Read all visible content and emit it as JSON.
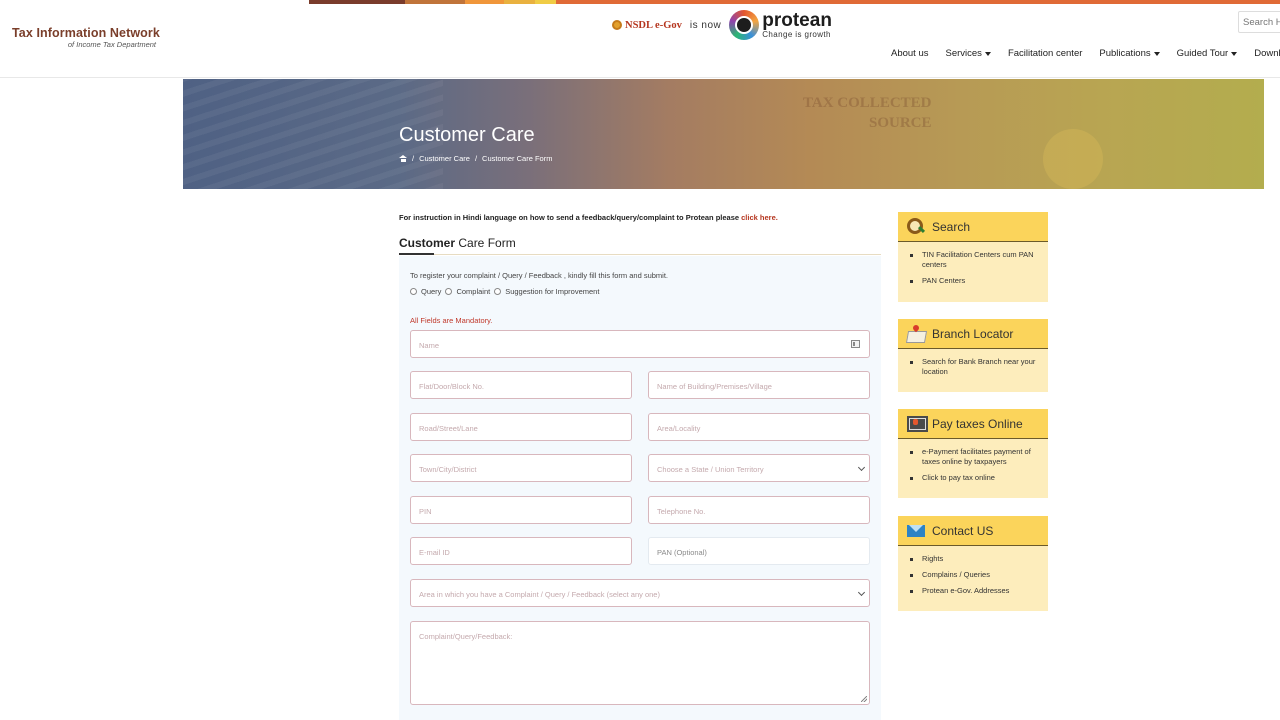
{
  "header": {
    "stripe_colors": [
      "#7a3c2c",
      "#c0743a",
      "#f0963a",
      "#e9b13f",
      "#f0cc45",
      "#e06a36"
    ],
    "logo_title": "Tax Information Network",
    "logo_subtitle": "of Income Tax Department",
    "brand_old": "NSDL e-Gov",
    "brand_connector": "is now",
    "brand_new": "protean",
    "brand_tagline": "Change is growth",
    "search_placeholder": "Search H",
    "nav": [
      {
        "label": "About us",
        "dropdown": false
      },
      {
        "label": "Services",
        "dropdown": true
      },
      {
        "label": "Facilitation center",
        "dropdown": false
      },
      {
        "label": "Publications",
        "dropdown": true
      },
      {
        "label": "Guided Tour",
        "dropdown": true
      },
      {
        "label": "Download",
        "dropdown": false
      }
    ]
  },
  "banner": {
    "title": "Customer Care",
    "breadcrumb": [
      "Customer Care",
      "Customer Care Form"
    ],
    "watermark": [
      "TAX COLLECTED",
      "SOURCE"
    ]
  },
  "main": {
    "instruction_text": "For instruction in Hindi language on how to send a feedback/query/complaint to Protean please ",
    "instruction_link": "click here.",
    "form_heading_bold": "Customer",
    "form_heading_rest": " Care Form",
    "intro": "To register your complaint / Query / Feedback , kindly fill this form and submit.",
    "radio_options": [
      "Query",
      "Complaint",
      "Suggestion for Improvement"
    ],
    "mandatory_note": "All Fields are Mandatory.",
    "fields": {
      "name": "Name",
      "flat": "Flat/Door/Block No.",
      "building": "Name of Building/Premises/Village",
      "road": "Road/Street/Lane",
      "area": "Area/Locality",
      "town": "Town/City/District",
      "state": "Choose a State / Union Territory",
      "pin": "PIN",
      "telephone": "Telephone No.",
      "email": "E-mail ID",
      "pan": "PAN (Optional)",
      "complaint_area": "Area in which you have a Complaint / Query / Feedback (select any one)",
      "message": "Complaint/Query/Feedback:"
    }
  },
  "sidebar": {
    "widgets": [
      {
        "title": "Search",
        "icon": "search-icon",
        "items": [
          "TIN Facilitation Centers cum PAN centers",
          "PAN Centers"
        ]
      },
      {
        "title": "Branch Locator",
        "icon": "map-pin-icon",
        "items": [
          "Search for Bank Branch near your location"
        ]
      },
      {
        "title": "Pay taxes Online",
        "icon": "monitor-icon",
        "items": [
          "e-Payment facilitates payment of taxes online by taxpayers",
          "Click to pay tax online"
        ]
      },
      {
        "title": "Contact US",
        "icon": "mail-icon",
        "items": [
          "Rights",
          "Complains / Queries",
          "Protean e-Gov. Addresses"
        ]
      }
    ]
  }
}
